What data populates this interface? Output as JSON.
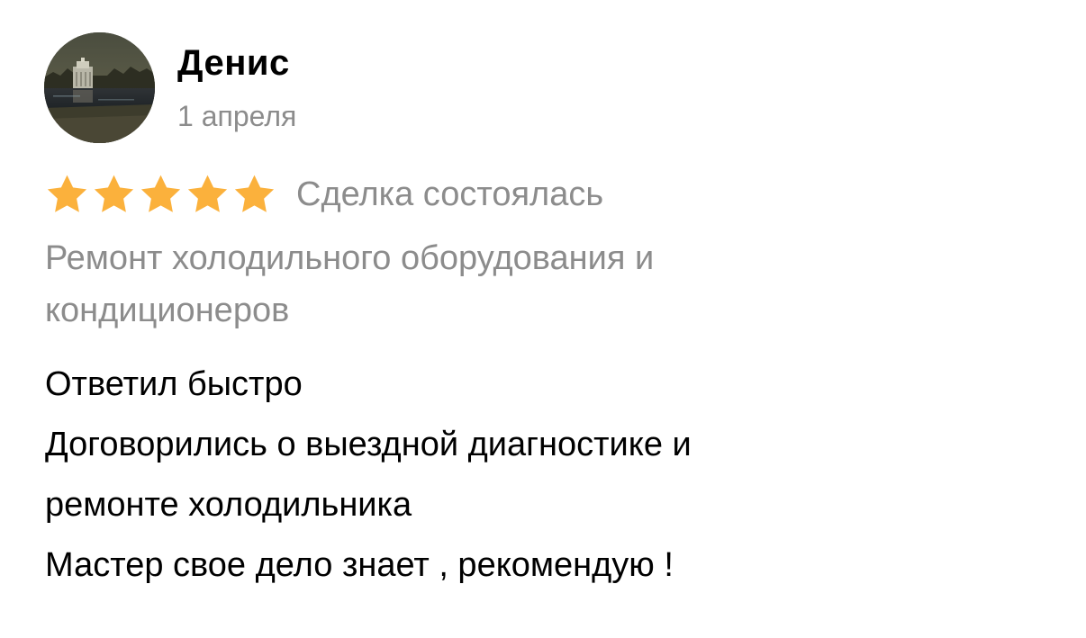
{
  "review": {
    "author_name": "Денис",
    "date": "1 апреля",
    "avatar_icon": "avatar-photo-icon",
    "rating": {
      "value": 5,
      "max": 5,
      "star_color": "#fbb13c"
    },
    "deal_status": "Сделка состоялась",
    "service_category_lines": [
      "Ремонт холодильного оборудования и",
      "кондиционеров"
    ],
    "text_lines": [
      "Ответил быстро",
      "Договорились о выездной диагностике и",
      "ремонте холодильника",
      "Мастер свое дело знает , рекомендую !"
    ]
  }
}
